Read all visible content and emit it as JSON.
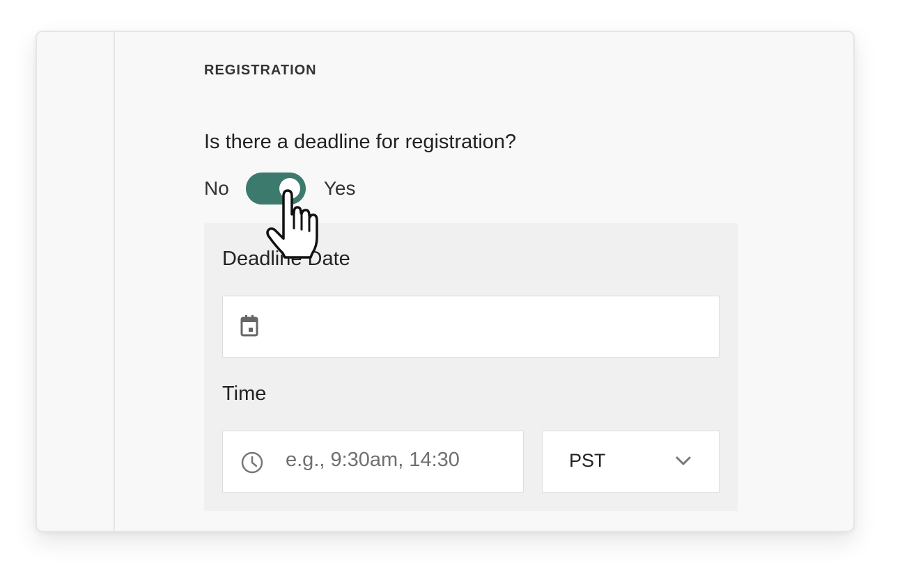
{
  "section": {
    "title": "REGISTRATION"
  },
  "deadline_question": {
    "text": "Is there a deadline for registration?",
    "toggle": {
      "off_label": "No",
      "on_label": "Yes",
      "state": "on"
    }
  },
  "deadline_fields": {
    "date_label": "Deadline Date",
    "date_icon": "calendar-icon",
    "time_label": "Time",
    "time_icon": "clock-icon",
    "time_placeholder": "e.g., 9:30am, 14:30",
    "timezone_selected": "PST",
    "timezone_icon": "chevron-down-icon"
  },
  "cursor": {
    "icon": "hand-pointer-icon"
  },
  "colors": {
    "toggle_on": "#3b7a6c",
    "panel_bg": "#f0f0f0",
    "card_bg": "#f8f8f8"
  }
}
